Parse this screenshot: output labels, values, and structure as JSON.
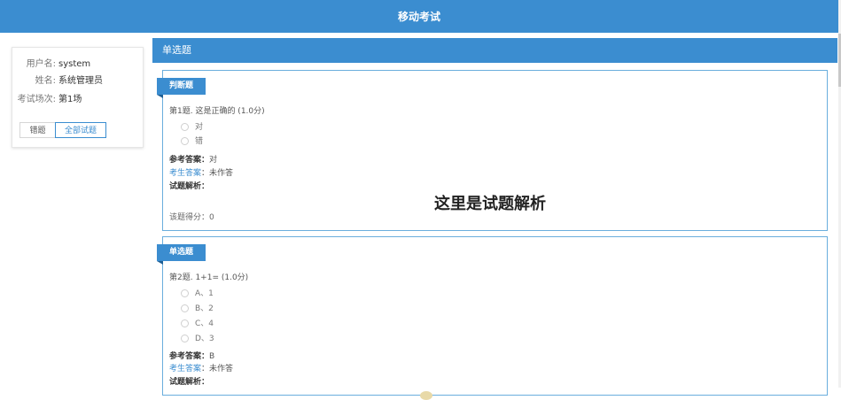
{
  "app": {
    "title": "移动考试"
  },
  "sidebar": {
    "username_label": "用户名:",
    "username": "system",
    "name_label": "姓名:",
    "name": "系统管理员",
    "session_label": "考试场次:",
    "session": "第1场",
    "wrong_button": "错题",
    "all_button": "全部试题"
  },
  "section": {
    "title": "单选题"
  },
  "questions": [
    {
      "tag": "判断题",
      "title": "第1题. 这是正确的 (1.0分)",
      "options": [
        "对",
        "错"
      ],
      "ref_label": "参考答案：",
      "ref_value": "对",
      "student_label": "考生答案",
      "student_value": "：未作答",
      "analysis_label": "试题解析：",
      "analysis_text": "这里是试题解析",
      "score_text": "该题得分：0"
    },
    {
      "tag": "单选题",
      "title": "第2题. 1+1= (1.0分)",
      "options": [
        "A、1",
        "B、2",
        "C、4",
        "D、3"
      ],
      "ref_label": "参考答案：",
      "ref_value": "B",
      "student_label": "考生答案",
      "student_value": "：未作答",
      "analysis_label": "试题解析："
    }
  ],
  "colors": {
    "primary": "#3b8dd0",
    "card_border": "#6aaedd"
  }
}
